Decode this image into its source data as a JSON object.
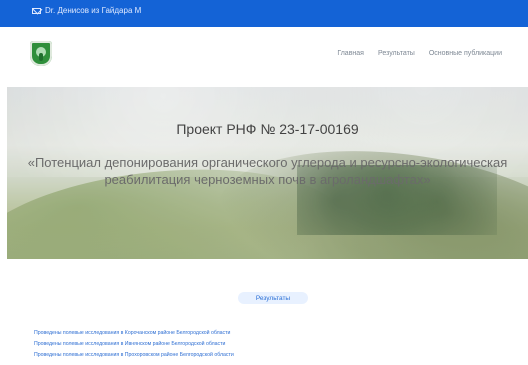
{
  "topbar": {
    "text": "Dr. Денисов из Гайдара М",
    "icon": "mail-icon",
    "bg": "#1463d6"
  },
  "header": {
    "nav": [
      {
        "label": "Главная"
      },
      {
        "label": "Результаты"
      },
      {
        "label": "Основные публикации"
      }
    ]
  },
  "hero": {
    "title": "Проект РНФ № 23-17-00169",
    "subtitle": "«Потенциал депонирования органического углерода и ресурсно-экологическая реабилитация черноземных почв в агроландшафтах»"
  },
  "section": {
    "label": "Результаты"
  },
  "links": [
    {
      "text": "Проведены полевые исследования в Корочанском районе Белгородской области"
    },
    {
      "text": "Проведены полевые исследования в Ивнянском районе Белгородской области"
    },
    {
      "text": "Проведены полевые исследования в Прохоровском районе Белгородской области"
    }
  ]
}
